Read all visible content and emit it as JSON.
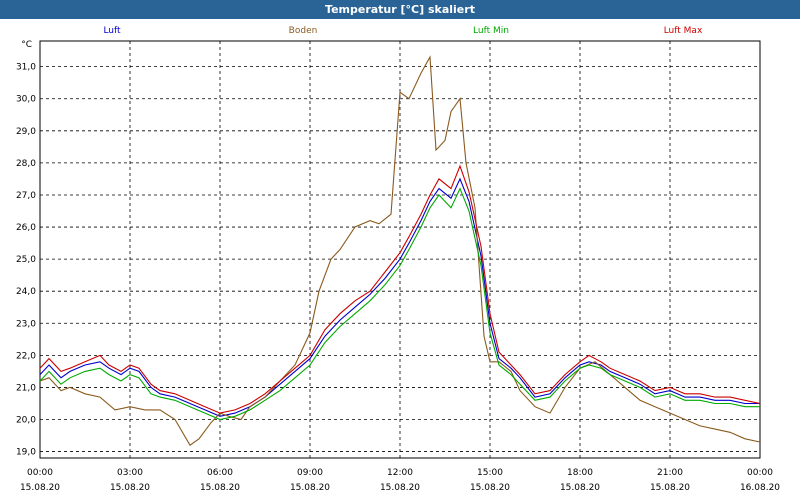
{
  "title": "Temperatur [°C] skaliert",
  "chart_data": {
    "type": "line",
    "title": "Temperatur [°C] skaliert",
    "ylabel": "°C",
    "xlabel": "",
    "ylim": [
      18.8,
      31.8
    ],
    "y_ticks": [
      19.0,
      20.0,
      21.0,
      22.0,
      23.0,
      24.0,
      25.0,
      26.0,
      27.0,
      28.0,
      29.0,
      30.0,
      31.0
    ],
    "y_tick_labels": [
      "19,0",
      "20,0",
      "21,0",
      "22,0",
      "23,0",
      "24,0",
      "25,0",
      "26,0",
      "27,0",
      "28,0",
      "29,0",
      "30,0",
      "31,0"
    ],
    "xlim": [
      0,
      24
    ],
    "x_ticks": [
      0,
      3,
      6,
      9,
      12,
      15,
      18,
      21,
      24
    ],
    "x_tick_labels": [
      [
        "00:00",
        "15.08.20"
      ],
      [
        "03:00",
        "15.08.20"
      ],
      [
        "06:00",
        "15.08.20"
      ],
      [
        "09:00",
        "15.08.20"
      ],
      [
        "12:00",
        "15.08.20"
      ],
      [
        "15:00",
        "15.08.20"
      ],
      [
        "18:00",
        "15.08.20"
      ],
      [
        "21:00",
        "15.08.20"
      ],
      [
        "00:00",
        "16.08.20"
      ]
    ],
    "grid": true,
    "legend_placement": "top",
    "series": [
      {
        "name": "Luft",
        "color": "#0000cc",
        "x": [
          0,
          0.3,
          0.7,
          1.0,
          1.5,
          2.0,
          2.3,
          2.7,
          3.0,
          3.3,
          3.7,
          4.0,
          4.5,
          5.0,
          5.5,
          6.0,
          6.5,
          7.0,
          7.5,
          8.0,
          8.5,
          9.0,
          9.5,
          10.0,
          10.5,
          11.0,
          11.5,
          12.0,
          12.3,
          12.7,
          13.0,
          13.3,
          13.7,
          14.0,
          14.3,
          14.7,
          15.0,
          15.3,
          15.7,
          16.0,
          16.5,
          17.0,
          17.5,
          18.0,
          18.3,
          18.7,
          19.0,
          19.5,
          20.0,
          20.5,
          21.0,
          21.5,
          22.0,
          22.5,
          23.0,
          23.5,
          24.0
        ],
        "y": [
          21.4,
          21.7,
          21.3,
          21.5,
          21.7,
          21.8,
          21.6,
          21.4,
          21.6,
          21.5,
          21.0,
          20.8,
          20.7,
          20.5,
          20.3,
          20.1,
          20.2,
          20.4,
          20.7,
          21.1,
          21.5,
          21.9,
          22.6,
          23.1,
          23.5,
          23.9,
          24.4,
          25.0,
          25.5,
          26.2,
          26.8,
          27.2,
          26.9,
          27.5,
          26.8,
          25.1,
          23.0,
          21.9,
          21.6,
          21.3,
          20.7,
          20.8,
          21.3,
          21.7,
          21.8,
          21.7,
          21.5,
          21.3,
          21.1,
          20.8,
          20.9,
          20.7,
          20.7,
          20.6,
          20.6,
          20.5,
          20.5
        ]
      },
      {
        "name": "Boden",
        "color": "#8b5a1e",
        "x": [
          0,
          0.3,
          0.7,
          1.0,
          1.5,
          2.0,
          2.5,
          3.0,
          3.5,
          4.0,
          4.5,
          5.0,
          5.3,
          5.7,
          6.0,
          6.3,
          6.7,
          7.0,
          7.5,
          8.0,
          8.5,
          9.0,
          9.3,
          9.7,
          10.0,
          10.5,
          11.0,
          11.3,
          11.7,
          12.0,
          12.3,
          12.7,
          13.0,
          13.2,
          13.5,
          13.7,
          14.0,
          14.2,
          14.5,
          14.8,
          15.0,
          15.3,
          15.7,
          16.0,
          16.5,
          17.0,
          17.5,
          18.0,
          18.5,
          19.0,
          19.5,
          20.0,
          20.5,
          21.0,
          21.5,
          22.0,
          22.5,
          23.0,
          23.5,
          24.0
        ],
        "y": [
          21.2,
          21.3,
          20.9,
          21.0,
          20.8,
          20.7,
          20.3,
          20.4,
          20.3,
          20.3,
          20.0,
          19.2,
          19.4,
          19.9,
          20.2,
          20.1,
          20.0,
          20.4,
          20.7,
          21.2,
          21.7,
          22.7,
          24.0,
          25.0,
          25.3,
          26.0,
          26.2,
          26.1,
          26.4,
          30.2,
          30.0,
          30.8,
          31.3,
          28.4,
          28.7,
          29.6,
          30.0,
          28.0,
          26.6,
          22.6,
          21.8,
          21.8,
          21.5,
          20.9,
          20.4,
          20.2,
          21.0,
          21.6,
          21.8,
          21.4,
          21.0,
          20.6,
          20.4,
          20.2,
          20.0,
          19.8,
          19.7,
          19.6,
          19.4,
          19.3
        ]
      },
      {
        "name": "Luft Min",
        "color": "#00aa00",
        "x": [
          0,
          0.3,
          0.7,
          1.0,
          1.5,
          2.0,
          2.3,
          2.7,
          3.0,
          3.3,
          3.7,
          4.0,
          4.5,
          5.0,
          5.5,
          6.0,
          6.5,
          7.0,
          7.5,
          8.0,
          8.5,
          9.0,
          9.5,
          10.0,
          10.5,
          11.0,
          11.5,
          12.0,
          12.3,
          12.7,
          13.0,
          13.3,
          13.7,
          14.0,
          14.3,
          14.7,
          15.0,
          15.3,
          15.7,
          16.0,
          16.5,
          17.0,
          17.5,
          18.0,
          18.3,
          18.7,
          19.0,
          19.5,
          20.0,
          20.5,
          21.0,
          21.5,
          22.0,
          22.5,
          23.0,
          23.5,
          24.0
        ],
        "y": [
          21.2,
          21.5,
          21.1,
          21.3,
          21.5,
          21.6,
          21.4,
          21.2,
          21.4,
          21.3,
          20.8,
          20.7,
          20.6,
          20.4,
          20.2,
          20.0,
          20.1,
          20.3,
          20.6,
          20.9,
          21.3,
          21.7,
          22.4,
          22.9,
          23.3,
          23.7,
          24.2,
          24.8,
          25.3,
          26.0,
          26.6,
          27.0,
          26.6,
          27.2,
          26.5,
          24.8,
          22.7,
          21.7,
          21.4,
          21.1,
          20.6,
          20.7,
          21.2,
          21.6,
          21.7,
          21.6,
          21.4,
          21.2,
          21.0,
          20.7,
          20.8,
          20.6,
          20.6,
          20.5,
          20.5,
          20.4,
          20.4
        ]
      },
      {
        "name": "Luft Max",
        "color": "#cc0000",
        "x": [
          0,
          0.3,
          0.7,
          1.0,
          1.5,
          2.0,
          2.3,
          2.7,
          3.0,
          3.3,
          3.7,
          4.0,
          4.5,
          5.0,
          5.5,
          6.0,
          6.5,
          7.0,
          7.5,
          8.0,
          8.5,
          9.0,
          9.5,
          10.0,
          10.5,
          11.0,
          11.5,
          12.0,
          12.3,
          12.7,
          13.0,
          13.3,
          13.7,
          14.0,
          14.3,
          14.7,
          15.0,
          15.3,
          15.7,
          16.0,
          16.5,
          17.0,
          17.5,
          18.0,
          18.3,
          18.7,
          19.0,
          19.5,
          20.0,
          20.5,
          21.0,
          21.5,
          22.0,
          22.5,
          23.0,
          23.5,
          24.0
        ],
        "y": [
          21.6,
          21.9,
          21.5,
          21.6,
          21.8,
          22.0,
          21.7,
          21.5,
          21.7,
          21.6,
          21.1,
          20.9,
          20.8,
          20.6,
          20.4,
          20.2,
          20.3,
          20.5,
          20.8,
          21.2,
          21.6,
          22.0,
          22.8,
          23.3,
          23.7,
          24.0,
          24.6,
          25.2,
          25.7,
          26.4,
          27.0,
          27.5,
          27.2,
          27.9,
          27.1,
          25.4,
          23.3,
          22.1,
          21.7,
          21.4,
          20.8,
          20.9,
          21.4,
          21.8,
          22.0,
          21.8,
          21.6,
          21.4,
          21.2,
          20.9,
          21.0,
          20.8,
          20.8,
          20.7,
          20.7,
          20.6,
          20.5
        ]
      }
    ]
  }
}
